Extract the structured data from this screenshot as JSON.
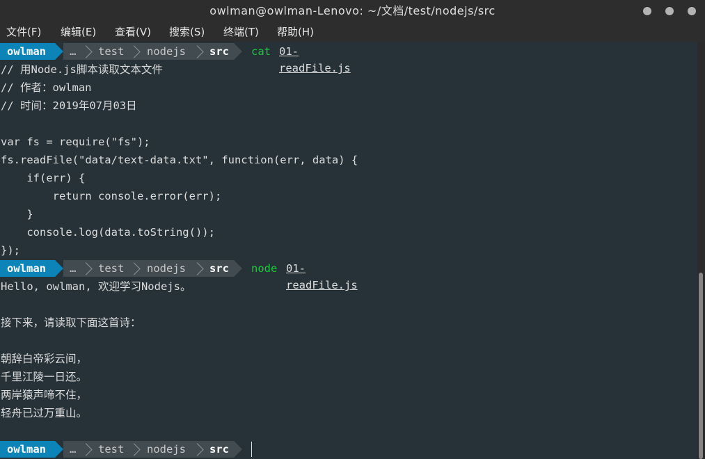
{
  "window": {
    "title": "owlman@owlman-Lenovo: ~/文档/test/nodejs/src"
  },
  "menu": [
    "文件(F)",
    "编辑(E)",
    "查看(V)",
    "搜索(S)",
    "终端(T)",
    "帮助(H)"
  ],
  "prompt": {
    "user": "owlman",
    "ellipsis": "…",
    "dir1": "test",
    "dir2": "nodejs",
    "dir3": "src"
  },
  "commands": [
    {
      "cmd": "cat",
      "arg": "01-readFile.js"
    },
    {
      "cmd": "node",
      "arg": "01-readFile.js"
    }
  ],
  "file_lines": [
    "// 用Node.js脚本读取文本文件",
    "// 作者：owlman",
    "// 时间：2019年07月03日",
    "",
    "var fs = require(\"fs\");",
    "fs.readFile(\"data/text-data.txt\", function(err, data) {",
    "    if(err) {",
    "        return console.error(err);",
    "    }",
    "    console.log(data.toString());",
    "});"
  ],
  "output_lines": [
    "Hello, owlman, 欢迎学习Nodejs。",
    "",
    "接下来，请读取下面这首诗：",
    "",
    "朝辞白帝彩云间，",
    "千里江陵一日还。",
    "两岸猿声啼不住，",
    "轻舟已过万重山。",
    ""
  ],
  "colors": {
    "user_bg": "#0d84b8",
    "path_bg": "#414b50",
    "cmd": "#1cc93c",
    "term_bg": "#263238"
  }
}
